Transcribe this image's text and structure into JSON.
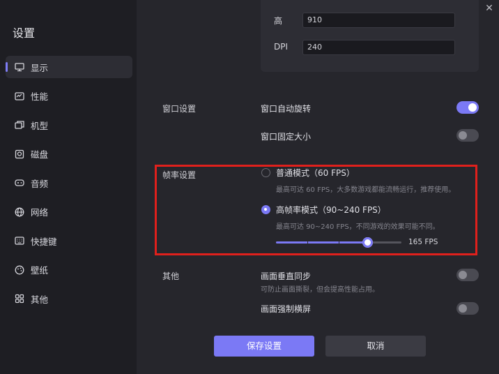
{
  "sidebar": {
    "title": "设置",
    "items": [
      {
        "label": "显示",
        "icon": "monitor-icon"
      },
      {
        "label": "性能",
        "icon": "performance-icon"
      },
      {
        "label": "机型",
        "icon": "device-model-icon"
      },
      {
        "label": "磁盘",
        "icon": "disk-icon"
      },
      {
        "label": "音频",
        "icon": "audio-icon"
      },
      {
        "label": "网络",
        "icon": "network-icon"
      },
      {
        "label": "快捷键",
        "icon": "keyboard-icon"
      },
      {
        "label": "壁纸",
        "icon": "wallpaper-icon"
      },
      {
        "label": "其他",
        "icon": "grid-icon"
      }
    ]
  },
  "window": {
    "close_glyph": "✕"
  },
  "resolution": {
    "height_label": "高",
    "height_value": "910",
    "dpi_label": "DPI",
    "dpi_value": "240"
  },
  "window_settings": {
    "section_label": "窗口设置",
    "auto_rotate_label": "窗口自动旋转",
    "auto_rotate_on": true,
    "fixed_size_label": "窗口固定大小",
    "fixed_size_on": false
  },
  "framerate": {
    "section_label": "帧率设置",
    "normal_label": "普通模式（60 FPS）",
    "normal_desc": "最高可达 60 FPS，大多数游戏都能流畅运行，推荐使用。",
    "high_label": "高帧率模式（90~240 FPS）",
    "high_desc": "最高可达 90~240 FPS，不同游戏的效果可能不同。",
    "selected": "high",
    "slider_value_text": "165 FPS",
    "slider_fraction": 0.73
  },
  "other": {
    "section_label": "其他",
    "vsync_label": "画面垂直同步",
    "vsync_desc": "可防止画面撕裂，但会提高性能占用。",
    "vsync_on": false,
    "force_landscape_label": "画面强制横屏",
    "force_landscape_on": false
  },
  "footer": {
    "save_label": "保存设置",
    "cancel_label": "取消"
  },
  "colors": {
    "accent": "#7b79f5",
    "highlight_box": "#e0201c",
    "background": "#26262c",
    "sidebar": "#1e1e23"
  }
}
